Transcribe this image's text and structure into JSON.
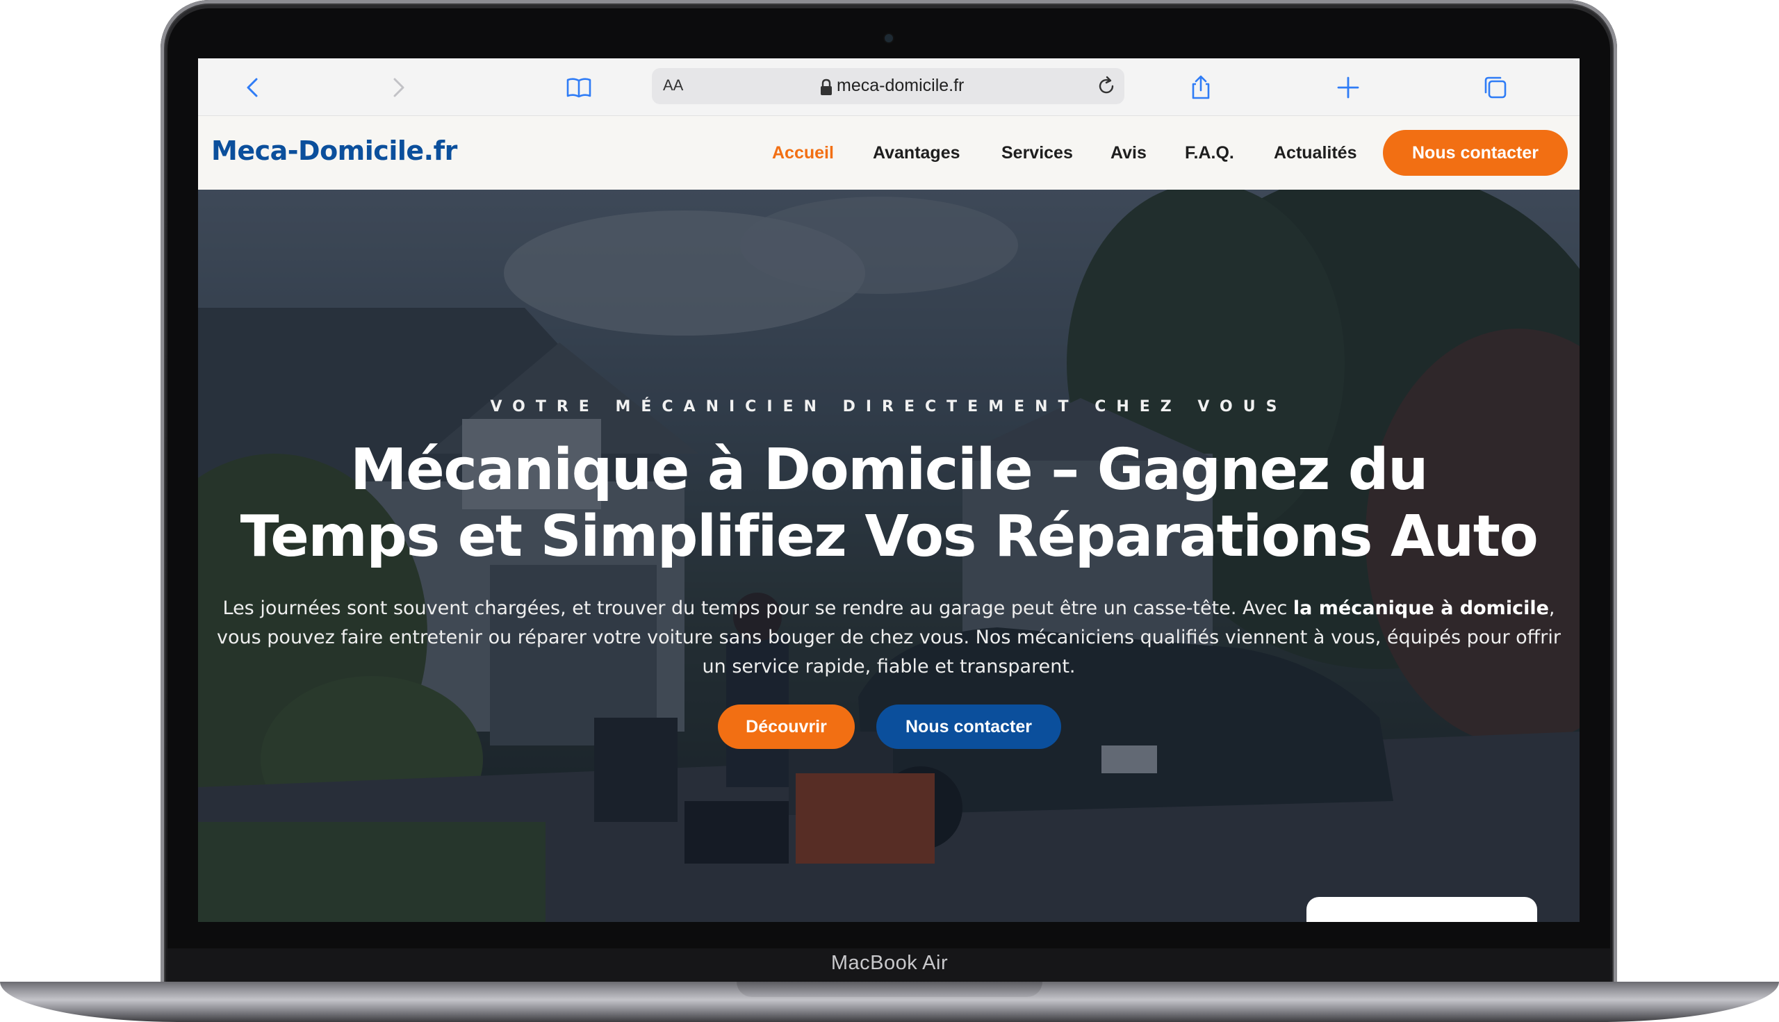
{
  "device": {
    "label": "MacBook Air"
  },
  "browser": {
    "reader_label": "AA",
    "url": "meca-domicile.fr",
    "icons": [
      "back-icon",
      "forward-icon",
      "bookmarks-icon",
      "lock-icon",
      "reload-icon",
      "share-icon",
      "new-tab-icon",
      "tabs-icon"
    ]
  },
  "site": {
    "logo": "Meca-Domicile.fr",
    "nav": [
      {
        "label": "Accueil",
        "active": true
      },
      {
        "label": "Avantages",
        "active": false
      },
      {
        "label": "Services",
        "active": false
      },
      {
        "label": "Avis",
        "active": false
      },
      {
        "label": "F.A.Q.",
        "active": false
      },
      {
        "label": "Actualités",
        "active": false
      }
    ],
    "header_cta": "Nous contacter",
    "colors": {
      "brand_blue": "#0b4f9c",
      "accent_orange": "#f26f13"
    }
  },
  "hero": {
    "eyebrow": "VOTRE MÉCANICIEN DIRECTEMENT CHEZ VOUS",
    "title_line1": "Mécanique à Domicile – Gagnez du",
    "title_line2": "Temps et Simplifiez Vos Réparations Auto",
    "text_before": "Les journées sont souvent chargées, et trouver du temps pour se rendre au garage peut être un casse-tête. Avec ",
    "text_bold": "la mécanique à domicile",
    "text_after": ", vous pouvez faire entretenir ou réparer votre voiture sans bouger de chez vous. Nos mécaniciens qualifiés viennent à vous, équipés pour offrir un service rapide, fiable et transparent.",
    "btn_discover": "Découvrir",
    "btn_contact": "Nous contacter"
  }
}
